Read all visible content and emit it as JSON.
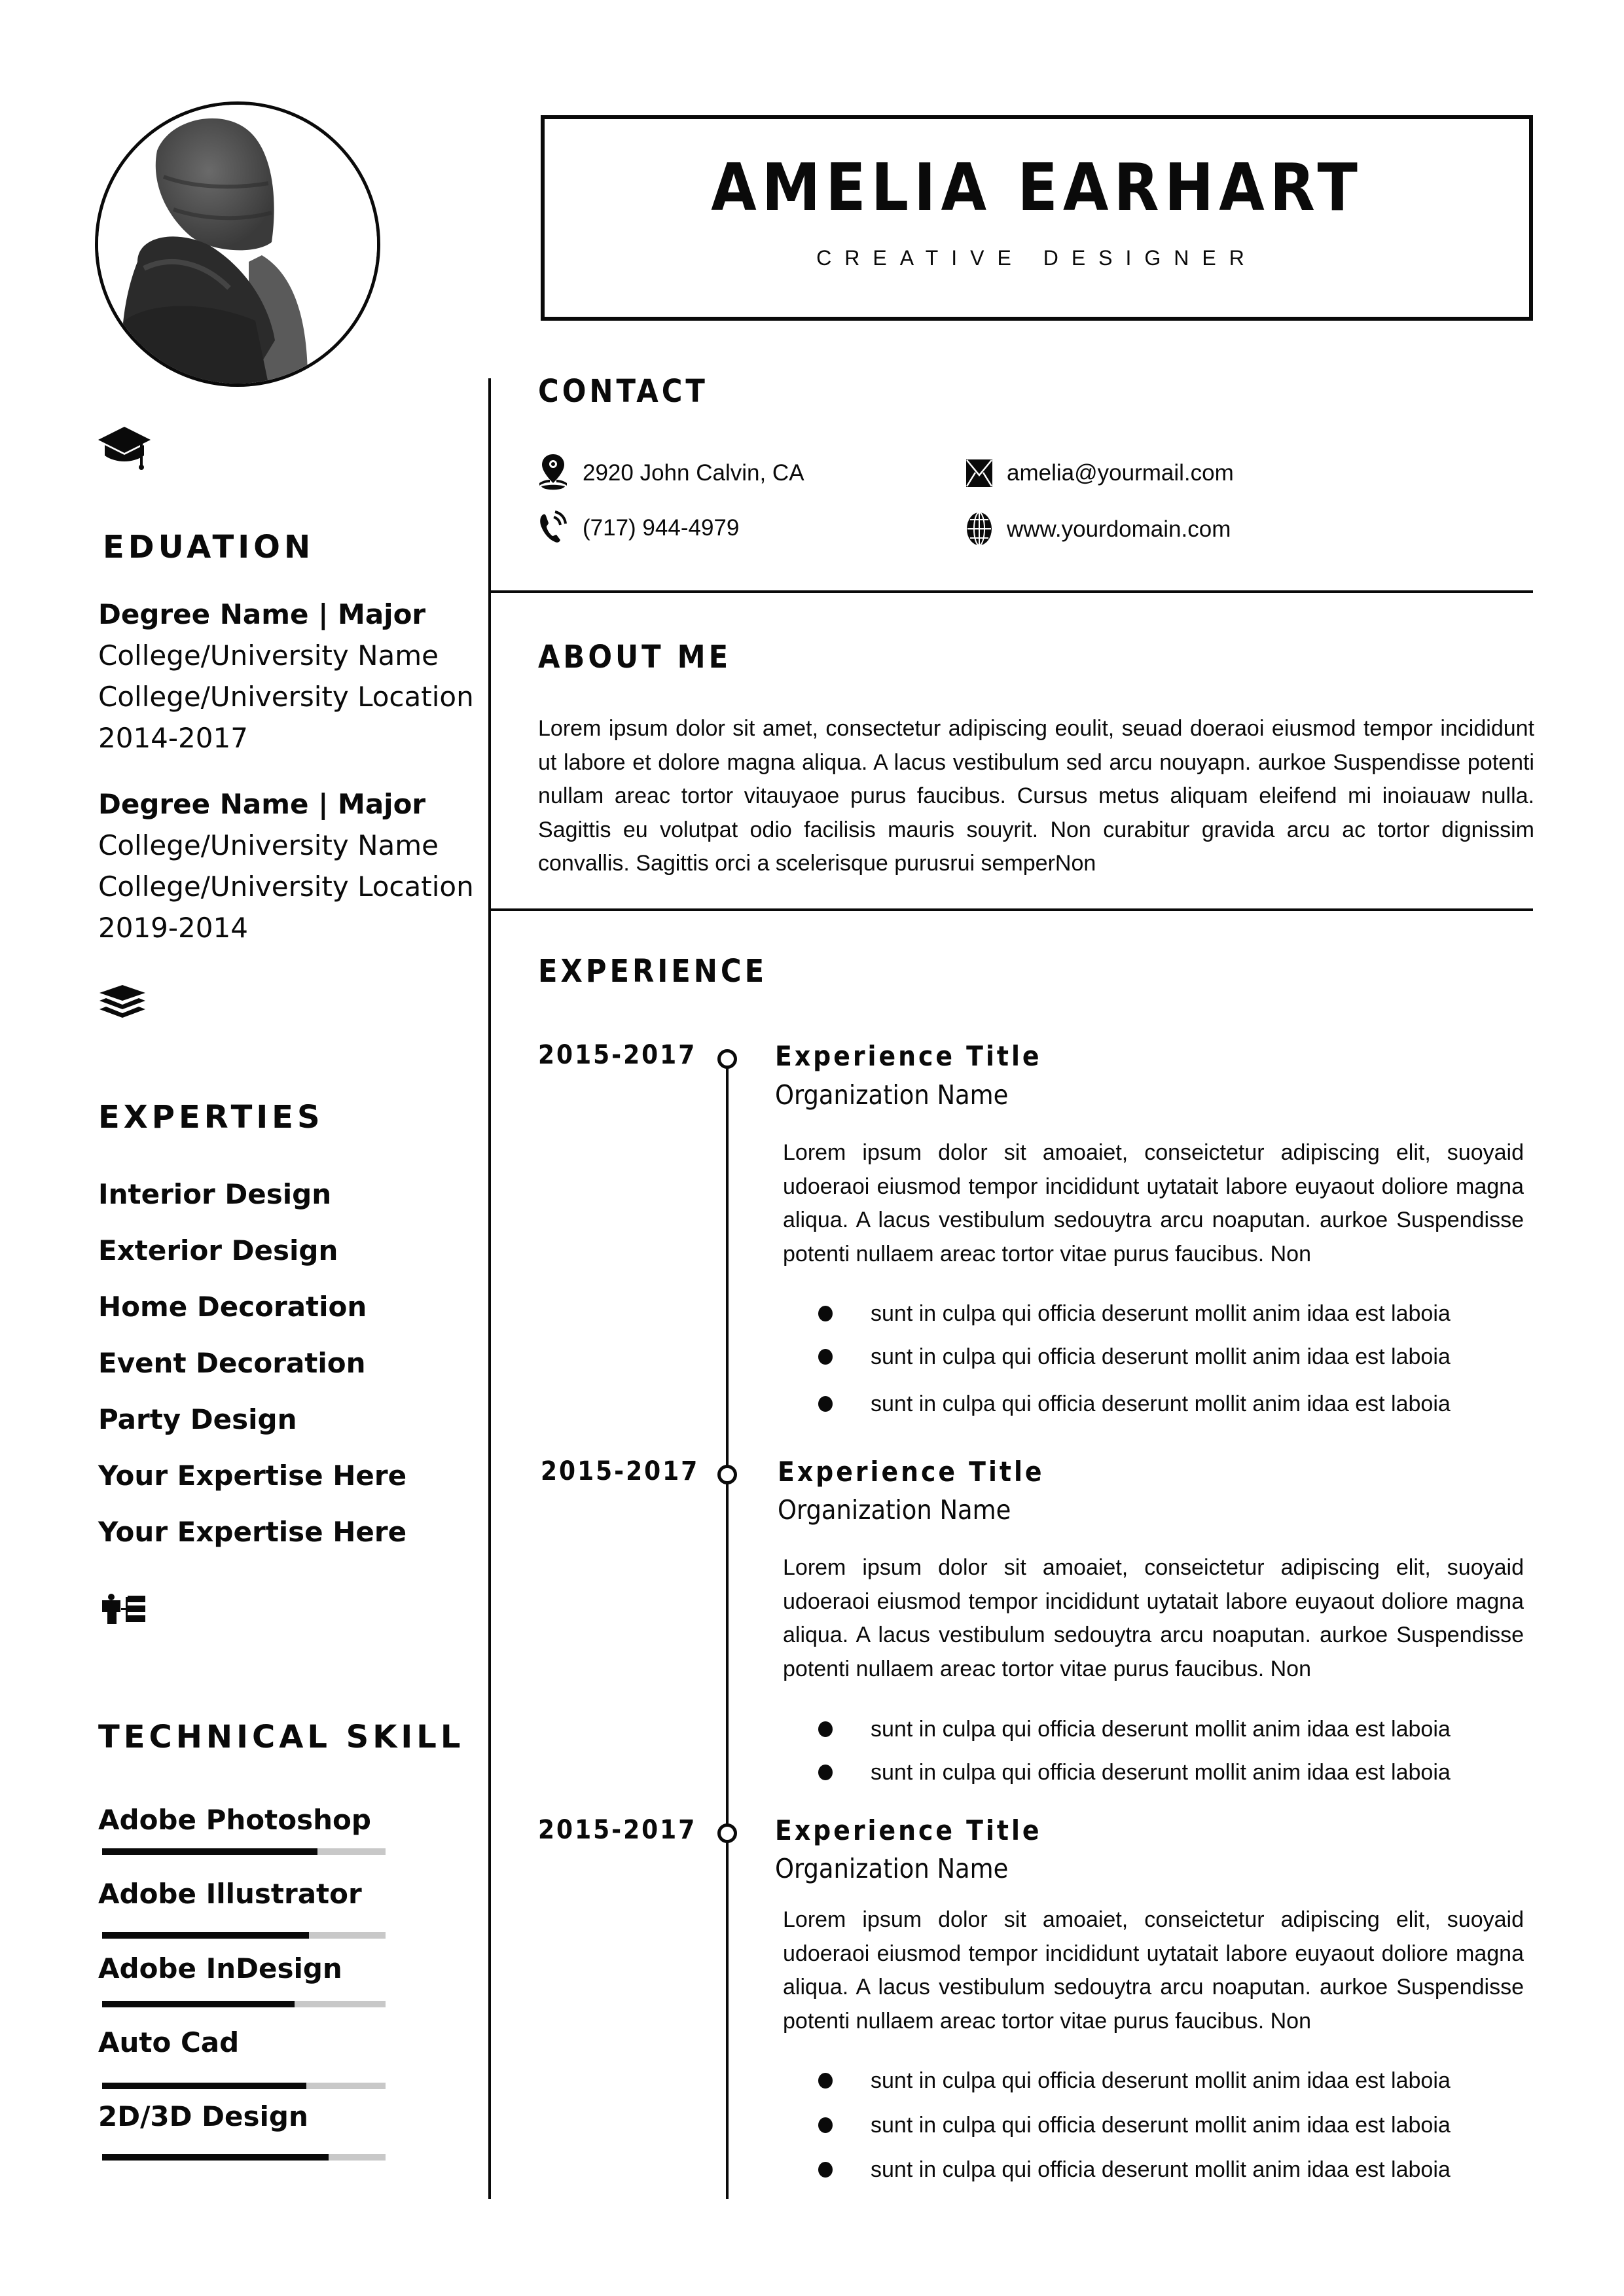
{
  "header": {
    "name": "AMELIA EARHART",
    "role": "CREATIVE DESIGNER"
  },
  "photo": {
    "alt": "profile-photo",
    "description": "grayscale photo of person in knit beanie and dark coat, seen from behind"
  },
  "contact": {
    "heading": "CONTACT",
    "address": "2920 John Calvin, CA",
    "phone": "(717) 944-4979",
    "email": "amelia@yourmail.com",
    "website": "www.yourdomain.com",
    "icons": [
      "location-pin-icon",
      "phone-icon",
      "envelope-icon",
      "globe-icon"
    ]
  },
  "about": {
    "heading": "ABOUT ME",
    "text": "Lorem ipsum dolor sit amet, consectetur adipiscing eoulit, seuad doeraoi eiusmod tempor incididunt ut labore et dolore magna aliqua. A lacus vestibulum sed arcu nouyapn. aurkoe Suspendisse potenti nullam areac tortor vitauyaoe purus faucibus. Cursus metus aliquam eleifend mi inoiauaw nulla. Sagittis eu volutpat odio facilisis mauris souyrit. Non curabitur gravida arcu ac tortor dignissim convallis. Sagittis orci a scelerisque purusrui semperNon"
  },
  "education": {
    "icon": "graduation-cap-icon",
    "heading": "EDUATION",
    "entries": [
      {
        "degree": "Degree Name | Major",
        "school": "College/University Name",
        "location": "College/University Location",
        "years": "2014-2017"
      },
      {
        "degree": "Degree Name | Major",
        "school": "College/University Name",
        "location": "College/University Location",
        "years": "2019-2014"
      }
    ]
  },
  "expertise": {
    "icon": "layers-icon",
    "heading": "EXPERTIES",
    "items": [
      "Interior Design",
      "Exterior Design",
      "Home Decoration",
      "Event Decoration",
      "Party Design",
      "Your Expertise Here",
      "Your Expertise Here"
    ]
  },
  "technical": {
    "icon": "org-chart-person-icon",
    "heading": "TECHNICAL SKILL",
    "skills": [
      {
        "name": "Adobe Photoshop",
        "level": 0.76
      },
      {
        "name": "Adobe Illustrator",
        "level": 0.73
      },
      {
        "name": "Adobe InDesign",
        "level": 0.68
      },
      {
        "name": "Auto Cad",
        "level": 0.72
      },
      {
        "name": "2D/3D Design",
        "level": 0.8
      }
    ]
  },
  "experience": {
    "heading": "EXPERIENCE",
    "entries": [
      {
        "dates": "2015-2017",
        "title": "Experience Title",
        "organization": "Organization Name",
        "description": "Lorem ipsum dolor sit amoaiet, conseictetur adipiscing elit, suoyaid udoeraoi eiusmod tempor incididunt uytatait labore euyaout doliore magna aliqua. A lacus vestibulum sedouytra arcu noaputan. aurkoe Suspendisse potenti nullaem areac tortor vitae purus faucibus. Non",
        "bullets": [
          "sunt in culpa qui officia deserunt mollit anim idaa est laboia",
          "sunt in culpa qui officia deserunt mollit anim idaa est laboia",
          "sunt in culpa qui officia deserunt mollit anim idaa est laboia"
        ]
      },
      {
        "dates": "2015-2017",
        "title": "Experience Title",
        "organization": "Organization Name",
        "description": "Lorem ipsum dolor sit amoaiet, conseictetur adipiscing elit, suoyaid udoeraoi eiusmod tempor incididunt uytatait labore euyaout doliore magna aliqua. A lacus vestibulum sedouytra arcu noaputan. aurkoe Suspendisse potenti nullaem areac tortor vitae purus faucibus. Non",
        "bullets": [
          "sunt in culpa qui officia deserunt mollit anim idaa est laboia",
          "sunt in culpa qui officia deserunt mollit anim idaa est laboia"
        ]
      },
      {
        "dates": "2015-2017",
        "title": "Experience Title",
        "organization": "Organization Name",
        "description": "Lorem ipsum dolor sit amoaiet, conseictetur adipiscing elit, suoyaid udoeraoi eiusmod tempor incididunt uytatait labore euyaout doliore magna aliqua. A lacus vestibulum sedouytra arcu noaputan. aurkoe Suspendisse potenti nullaem areac tortor vitae purus faucibus. Non",
        "bullets": [
          "sunt in culpa qui officia deserunt mollit anim idaa est laboia",
          "sunt in culpa qui officia deserunt mollit anim idaa est laboia",
          "sunt in culpa qui officia deserunt mollit anim idaa est laboia"
        ]
      }
    ]
  }
}
